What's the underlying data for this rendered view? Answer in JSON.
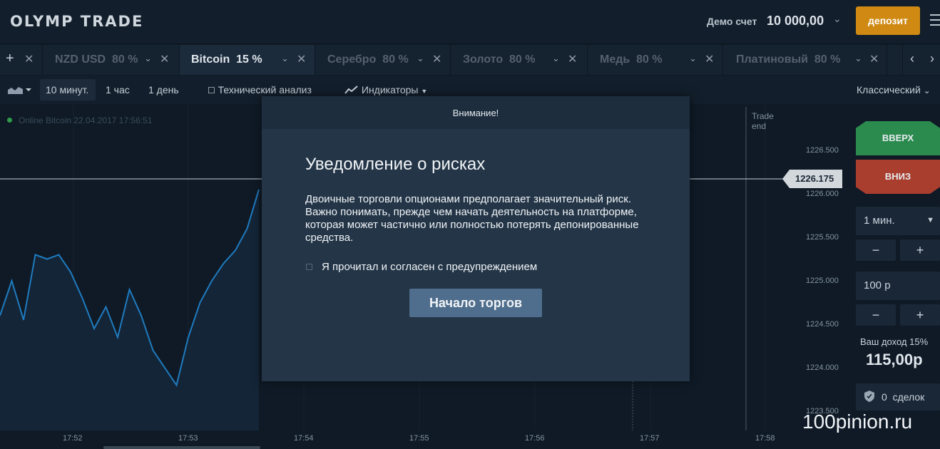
{
  "header": {
    "logo": "OLYMP TRADE",
    "account_label": "Демо счет",
    "account_balance": "10 000,00",
    "deposit_label": "депозит"
  },
  "tabs": [
    {
      "name": "NZD USD",
      "pct": "80 %",
      "active": false
    },
    {
      "name": "Bitcoin",
      "pct": "15 %",
      "active": true
    },
    {
      "name": "Серебро",
      "pct": "80 %",
      "active": false
    },
    {
      "name": "Золото",
      "pct": "80 %",
      "active": false
    },
    {
      "name": "Медь",
      "pct": "80 %",
      "active": false
    },
    {
      "name": "Платиновый",
      "pct": "80 %",
      "active": false
    }
  ],
  "toolbar": {
    "intervals": [
      "10 минут.",
      "1 час",
      "1 день"
    ],
    "active_interval": "10 минут.",
    "technical_analysis": "Технический анализ",
    "indicators": "Индикаторы",
    "chart_style": "Классический"
  },
  "chart": {
    "online_label": "Online Bitcoin 22.04.2017 17:56:51",
    "current_price": "1226.175",
    "trade_end_label": "Trade\nend",
    "y_ticks": [
      "1226.500",
      "1226.000",
      "1225.500",
      "1225.000",
      "1224.500",
      "1224.000",
      "1223.500"
    ],
    "x_ticks": [
      "17:52",
      "17:53",
      "17:54",
      "17:55",
      "17:56",
      "17:57",
      "17:58"
    ]
  },
  "chart_data": {
    "type": "area",
    "title": "",
    "xlabel": "",
    "ylabel": "",
    "ylim": [
      1223.5,
      1226.75
    ],
    "x": [
      "17:51:40",
      "17:51:45",
      "17:51:50",
      "17:51:55",
      "17:52:00",
      "17:52:05",
      "17:52:10",
      "17:52:15",
      "17:52:20",
      "17:52:25",
      "17:52:30",
      "17:52:35",
      "17:52:40",
      "17:52:45",
      "17:52:50",
      "17:52:55",
      "17:53:00",
      "17:53:05",
      "17:53:10",
      "17:53:15",
      "17:53:20",
      "17:53:25",
      "17:53:30"
    ],
    "values": [
      1224.6,
      1225.0,
      1224.55,
      1225.3,
      1225.25,
      1225.3,
      1225.1,
      1224.8,
      1224.45,
      1224.7,
      1224.35,
      1224.9,
      1224.6,
      1224.2,
      1224.0,
      1223.8,
      1224.35,
      1224.75,
      1225.0,
      1225.2,
      1225.35,
      1225.6,
      1226.05
    ]
  },
  "panel": {
    "up_label": "ВВЕРХ",
    "down_label": "ВНИЗ",
    "duration": "1 мин.",
    "amount": "100 р",
    "minus": "−",
    "plus": "+",
    "income_label": "Ваш доход 15%",
    "income_value": "115,00р",
    "deals_label": "0  сделок"
  },
  "modal": {
    "header": "Внимание!",
    "title": "Уведомление о рисках",
    "body": "Двоичные торговли опционами предполагает значительный риск. Важно понимать, прежде чем начать деятельность на платформе, которая может частично или полностью потерять депонированные средства.",
    "checkbox_label": "Я прочитал и согласен с предупреждением",
    "start_button": "Начало торгов"
  },
  "watermark": "100pinion.ru",
  "colors": {
    "deposit": "#d08a14",
    "up": "#2b8a4e",
    "down": "#a93d2e",
    "line": "#1f7bbf",
    "modal_bg": "#233547"
  }
}
